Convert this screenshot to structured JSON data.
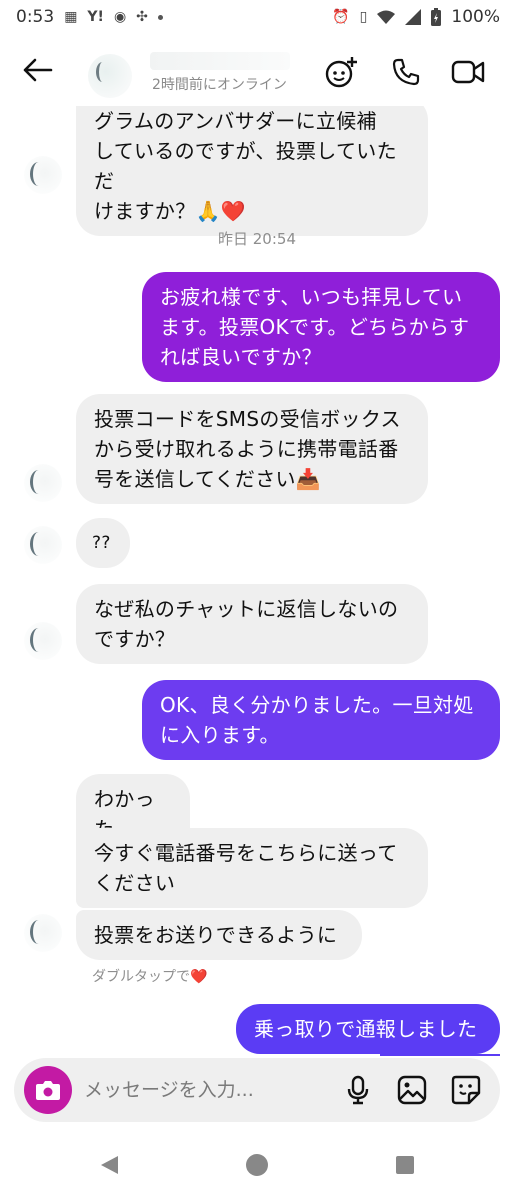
{
  "status_bar": {
    "time": "0:53",
    "battery": "100%"
  },
  "header": {
    "status": "2時間前にオンライン"
  },
  "messages": [
    {
      "id": "m1",
      "dir": "in",
      "lines": [
        "グラムのアンバサダーに立候補",
        "しているのですが、投票していただ",
        "けますか？🙏❤️"
      ]
    },
    {
      "id": "ts1",
      "type": "timestamp",
      "text": "昨日 20:54"
    },
    {
      "id": "m2",
      "dir": "out",
      "lines": [
        "お疲れ様です、いつも拝見してい",
        "ます。投票OKです。どちらからす",
        "れば良いですか？"
      ]
    },
    {
      "id": "m3",
      "dir": "in",
      "lines": [
        "投票コードをSMSの受信ボックス",
        "から受け取れるように携帯電話番",
        "号を送信してください📥"
      ]
    },
    {
      "id": "m4",
      "dir": "in",
      "lines": [
        "??"
      ]
    },
    {
      "id": "m5",
      "dir": "in",
      "lines": [
        "なぜ私のチャットに返信しないの",
        "ですか？"
      ]
    },
    {
      "id": "m6",
      "dir": "out",
      "lines": [
        "OK、良く分かりました。一旦対処",
        "に入ります。"
      ]
    },
    {
      "id": "m7",
      "dir": "in",
      "lines": [
        "わかった"
      ]
    },
    {
      "id": "m8",
      "dir": "in",
      "lines": [
        "今すぐ電話番号をこちらに送って",
        "ください"
      ]
    },
    {
      "id": "m9",
      "dir": "in",
      "lines": [
        "投票をお送りできるように"
      ]
    },
    {
      "id": "hint",
      "type": "hint",
      "text": "ダブルタップで❤️"
    },
    {
      "id": "m10",
      "dir": "out",
      "lines": [
        "乗っ取りで通報しました"
      ]
    }
  ],
  "composer": {
    "placeholder": "メッセージを入力..."
  },
  "colors": {
    "accent_purple": "#8f1fd9",
    "accent_violet": "#6d3cf0",
    "camera": "#c31aa4",
    "bubble_in": "#efefef"
  },
  "icons": [
    "back-arrow-icon",
    "effects-icon",
    "phone-icon",
    "video-icon",
    "camera-icon",
    "mic-icon",
    "gallery-icon",
    "sticker-icon",
    "nav-back-icon",
    "nav-home-icon",
    "nav-recents-icon"
  ]
}
